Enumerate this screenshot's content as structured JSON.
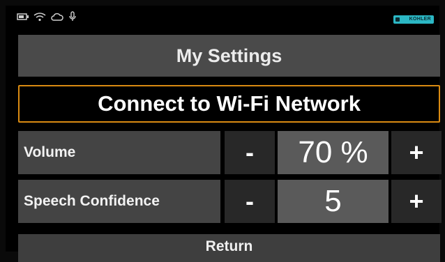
{
  "status_bar": {
    "icons": [
      "battery-icon",
      "wifi-icon",
      "cloud-icon",
      "microphone-icon"
    ],
    "brand_badge": "KOHLER"
  },
  "title": "My Settings",
  "wifi_button_label": "Connect to Wi-Fi Network",
  "settings": {
    "volume": {
      "label": "Volume",
      "minus": "-",
      "value": "70 %",
      "plus": "+"
    },
    "speech_confidence": {
      "label": "Speech Confidence",
      "minus": "-",
      "value": "5",
      "plus": "+"
    }
  },
  "return_label": "Return",
  "colors": {
    "accent_border": "#d98a12",
    "badge": "#2bb7c4",
    "title_bar": "#4a4a4a",
    "value_box": "#5a5a5a"
  }
}
